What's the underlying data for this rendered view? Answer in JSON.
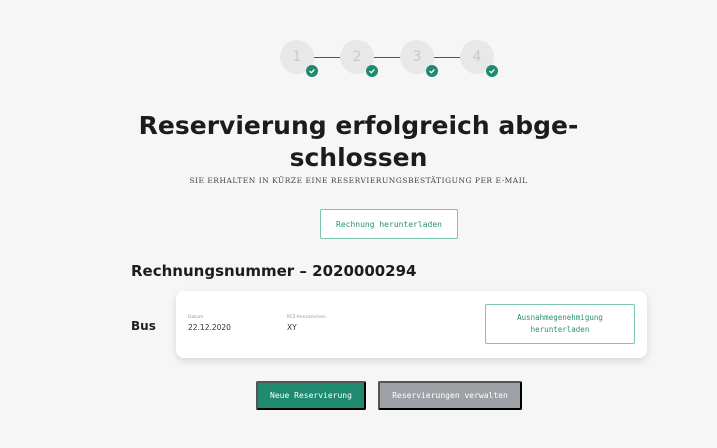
{
  "stepper": {
    "steps": [
      {
        "number": "1",
        "state": "completed"
      },
      {
        "number": "2",
        "state": "completed"
      },
      {
        "number": "3",
        "state": "completed"
      },
      {
        "number": "4",
        "state": "completed"
      }
    ]
  },
  "header": {
    "title": "Reservierung erfolgreich abge-\nschlossen",
    "subtitle": "SIE ERHALTEN IN KÜRZE EINE RESERVIERUNGSBESTÄTIGUNG PER E-MAIL"
  },
  "invoice": {
    "download_label": "Rechnung herunterladen",
    "number_label": "Rechnungsnummer – 2020000294"
  },
  "reservation": {
    "vehicle_type": "Bus",
    "date_label": "Datum",
    "date_value": "22.12.2020",
    "plate_label": "KFZ-Kennzeichen",
    "plate_value": "XY",
    "permit_button_line1": "Ausnahmegenehmigung",
    "permit_button_line2": "herunterladen"
  },
  "actions": {
    "new_label": "Neue Reservierung",
    "manage_label": "Reservierungen verwalten"
  },
  "colors": {
    "accent": "#1f8a70",
    "secondary_button": "#9ea2a6",
    "background": "#f6f6f6"
  },
  "icons": {
    "step_done": "check-icon"
  }
}
